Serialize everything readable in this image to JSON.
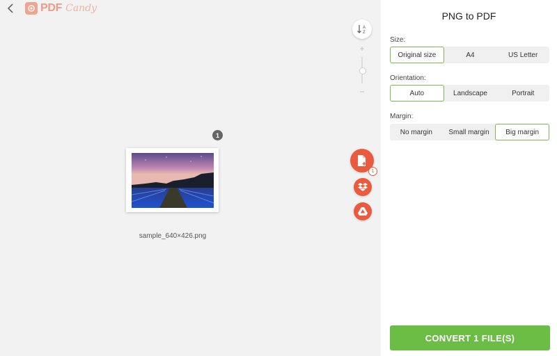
{
  "app": {
    "logo_text": "PDF",
    "logo_text2": "Candy"
  },
  "left_panel": {
    "file_count": "1",
    "filename": "sample_640×426.png",
    "sort_label_top": "A",
    "sort_label_bottom": "Z",
    "zoom_plus": "+",
    "zoom_minus": "−",
    "add_badge": "1"
  },
  "right_panel": {
    "title": "PNG to PDF",
    "size": {
      "label": "Size:",
      "options": [
        "Original size",
        "A4",
        "US Letter"
      ],
      "selected": "Original size"
    },
    "orientation": {
      "label": "Orientation:",
      "options": [
        "Auto",
        "Landscape",
        "Portrait"
      ],
      "selected": "Auto"
    },
    "margin": {
      "label": "Margin:",
      "options": [
        "No margin",
        "Small margin",
        "Big margin"
      ],
      "selected": "Big margin"
    },
    "convert_label": "CONVERT 1 FILE(S)"
  },
  "colors": {
    "accent_green": "#6bbd45",
    "selected_border": "#79b852",
    "fab_red": "#ea5a3f",
    "logo": "#ef9a86"
  }
}
